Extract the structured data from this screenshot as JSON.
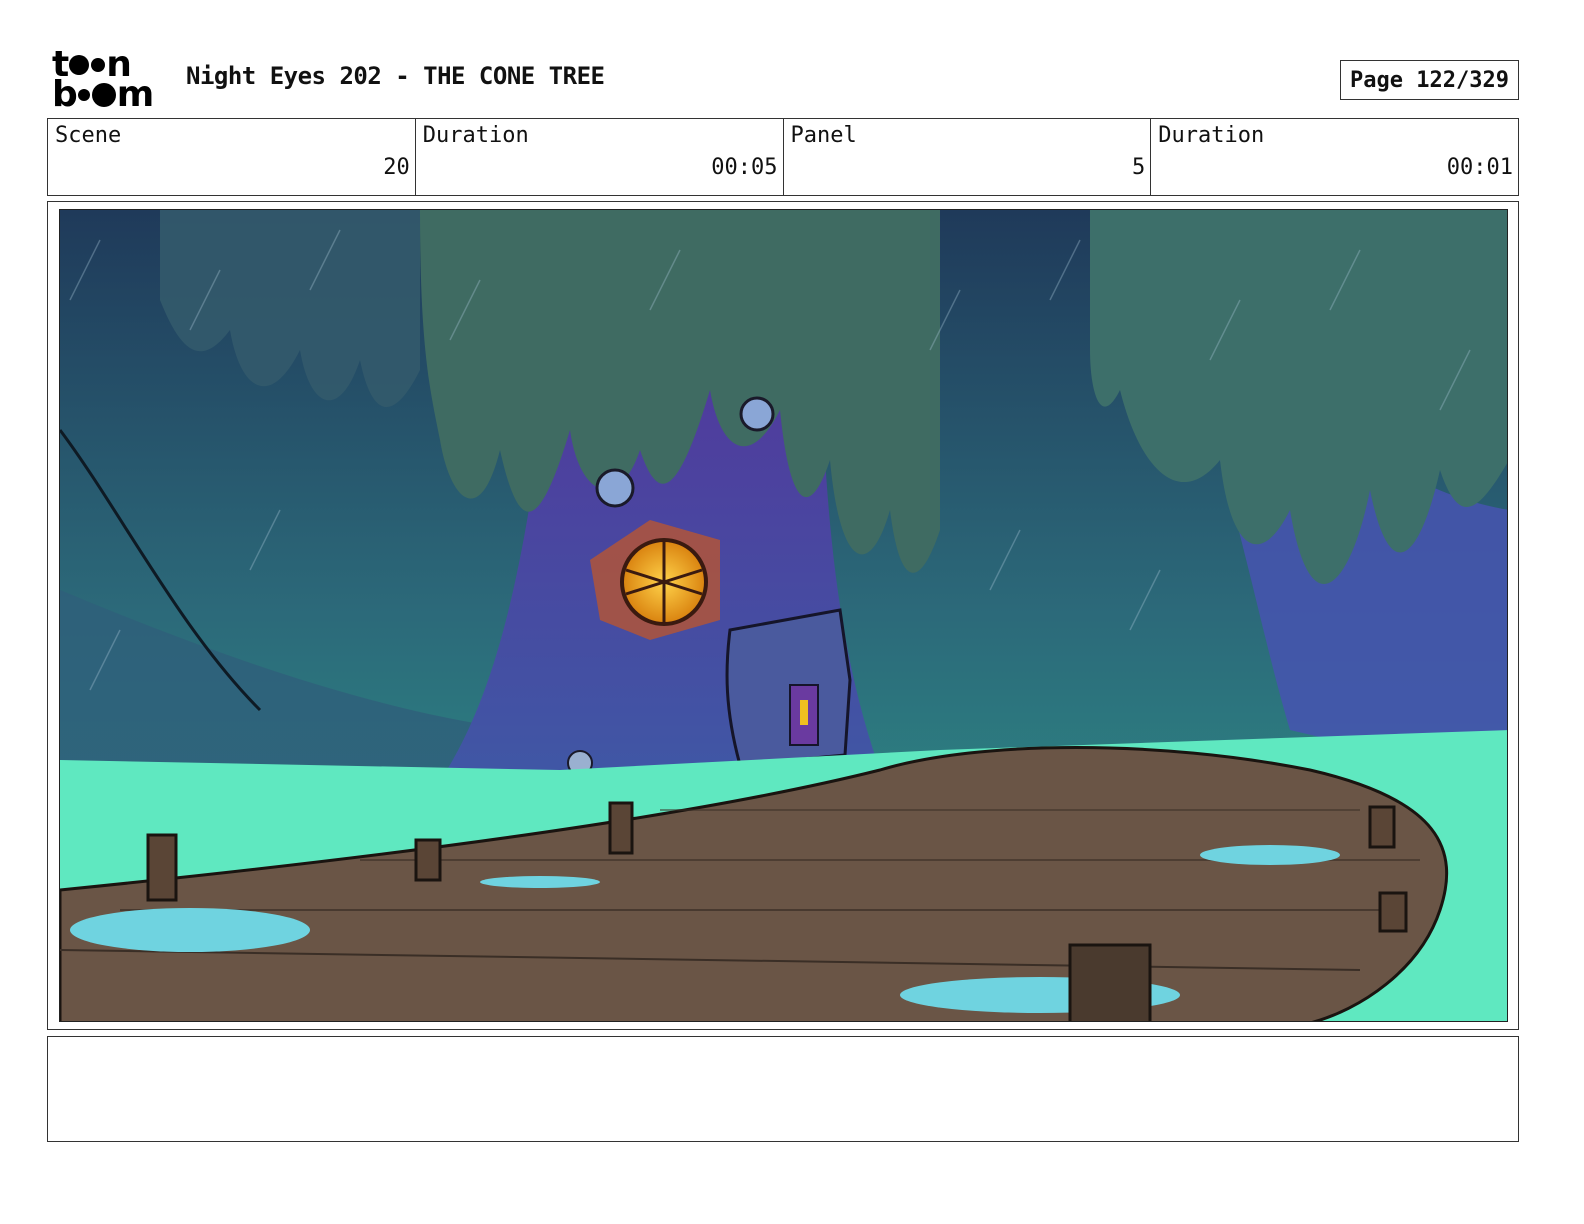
{
  "header": {
    "logo_line1": "t  n",
    "logo_line2": "b  m",
    "title": "Night Eyes 202 - THE CONE TREE",
    "page_label": "Page 122/329"
  },
  "info": {
    "scene_label": "Scene",
    "scene_value": "20",
    "scene_duration_label": "Duration",
    "scene_duration_value": "00:05",
    "panel_label": "Panel",
    "panel_value": "5",
    "panel_duration_label": "Duration",
    "panel_duration_value": "00:01"
  },
  "notes": {
    "text": ""
  },
  "colors": {
    "sky_top": "#1f3a5a",
    "foliage": "#3f6b62",
    "trunk": "#4a4aa8",
    "water": "#5fe8c0",
    "boardwalk": "#6a5546",
    "puddle": "#6fd3e0",
    "window_glow": "#f0a51a"
  }
}
